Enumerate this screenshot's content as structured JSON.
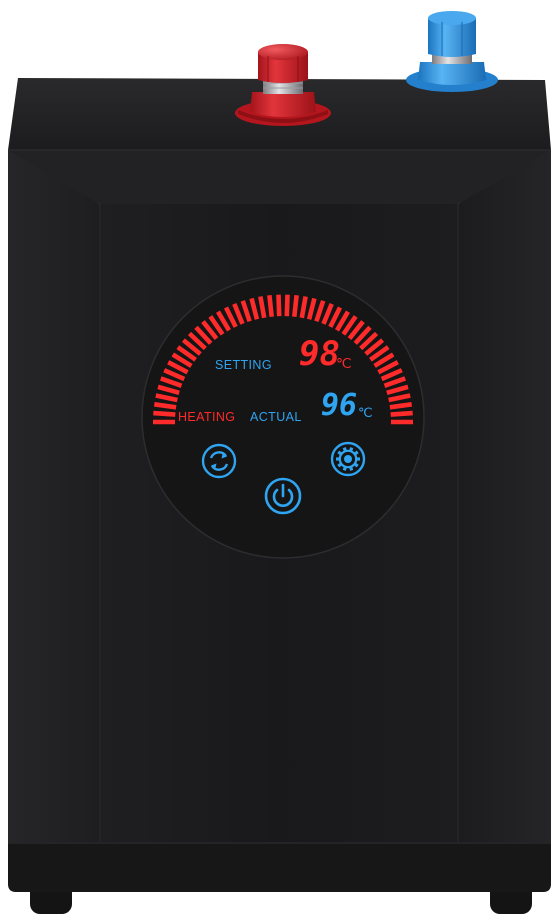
{
  "display": {
    "setting_label": "SETTING",
    "setting_value": "98",
    "setting_unit": "℃",
    "heating_label": "HEATING",
    "actual_label": "ACTUAL",
    "actual_value": "96",
    "actual_unit": "℃"
  },
  "controls": [
    {
      "name": "refresh-icon",
      "interactable": true
    },
    {
      "name": "settings-gear-icon",
      "interactable": true
    },
    {
      "name": "power-icon",
      "interactable": true
    }
  ],
  "colors": {
    "body": "#1b1b1d",
    "hot_valve": "#d3232a",
    "cold_valve": "#2e8fdc",
    "display_red": "#ff2a2a",
    "display_blue": "#2fa4f0"
  }
}
